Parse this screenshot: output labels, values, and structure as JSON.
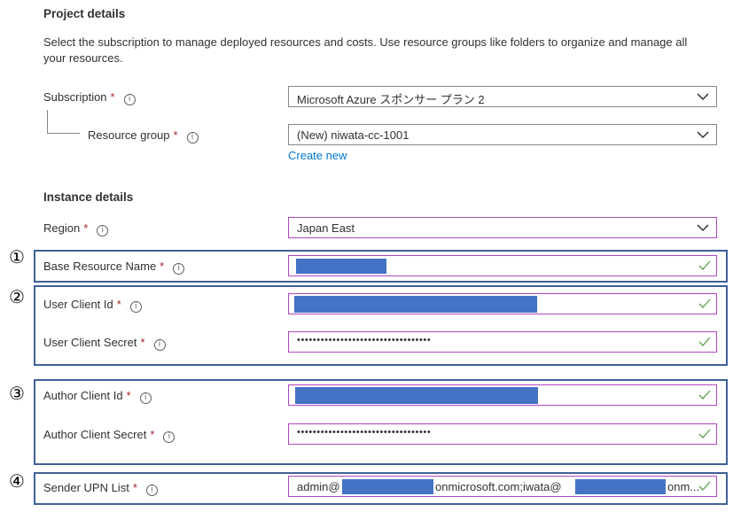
{
  "project": {
    "heading": "Project details",
    "description": "Select the subscription to manage deployed resources and costs. Use resource groups like folders to organize and manage all your resources."
  },
  "subscription": {
    "label": "Subscription",
    "value": "Microsoft Azure スポンサー プラン 2"
  },
  "resource_group": {
    "label": "Resource group",
    "value": "(New) niwata-cc-1001",
    "create_new": "Create new"
  },
  "instance": {
    "heading": "Instance details"
  },
  "region": {
    "label": "Region",
    "value": "Japan East"
  },
  "base_resource_name": {
    "label": "Base Resource Name"
  },
  "user_client_id": {
    "label": "User Client Id"
  },
  "user_client_secret": {
    "label": "User Client Secret",
    "masked": "••••••••••••••••••••••••••••••••••"
  },
  "author_client_id": {
    "label": "Author Client Id"
  },
  "author_client_secret": {
    "label": "Author Client Secret",
    "masked": "••••••••••••••••••••••••••••••••••"
  },
  "sender_upn_list": {
    "label": "Sender UPN List",
    "part1": "admin@",
    "part2": "onmicrosoft.com;iwata@",
    "part3": "onm..."
  },
  "markers": {
    "one": "①",
    "two": "②",
    "three": "③",
    "four": "④"
  },
  "common": {
    "required": "*",
    "info_glyph": "i"
  },
  "colors": {
    "accent_border": "#b146c2",
    "group_border": "#3f6096",
    "redaction": "#4472c4",
    "valid_check": "#5c9e4c",
    "link": "#0078d4"
  }
}
